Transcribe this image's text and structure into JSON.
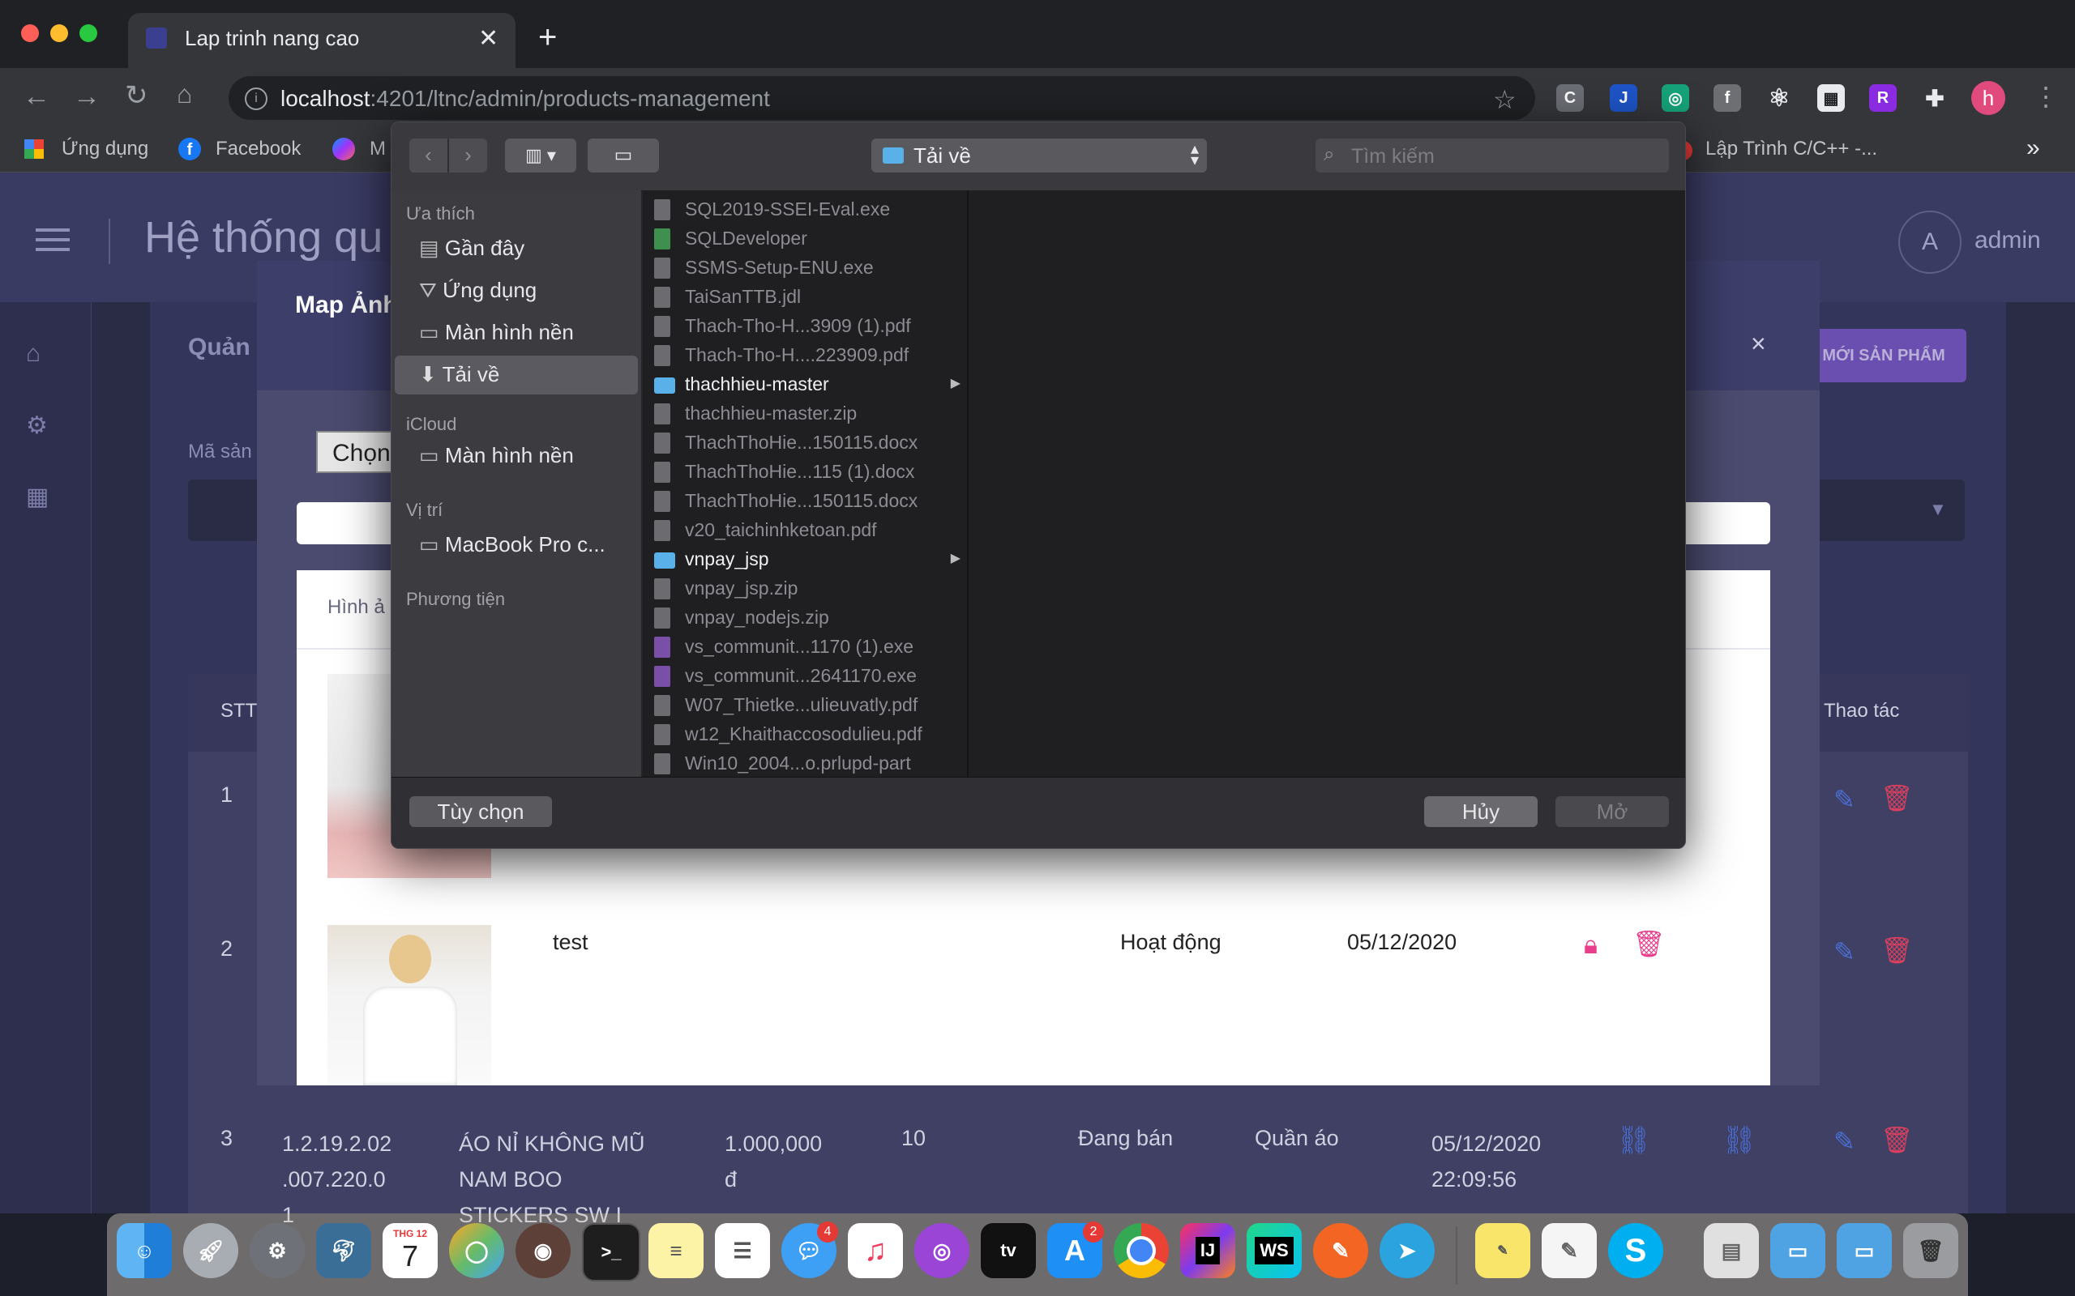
{
  "browser": {
    "tab_title": "Lap trinh nang cao",
    "url_host": "localhost",
    "url_path": ":4201/ltnc/admin/products-management",
    "profile_initial": "h",
    "bookmarks": [
      "Ứng dụng",
      "Facebook",
      "M",
      "Lập Trình C/C++ -..."
    ],
    "more_bookmarks": "»"
  },
  "app": {
    "title": "Hệ thống qu",
    "avatar_initial": "A",
    "user": "admin",
    "section": "Quản l",
    "filter_label": "Mã sản",
    "add_button": "M MỚI SẢN PHẨM",
    "columns": {
      "stt": "STT",
      "actions": "Thao tác"
    },
    "rows": [
      {
        "stt": "1"
      },
      {
        "stt": "2"
      },
      {
        "stt": "3",
        "code": [
          "1.2.19.2.02",
          ".007.220.0",
          "1"
        ],
        "name": [
          "ÁO NỈ KHÔNG MŨ",
          "NAM BOO",
          "STICKERS SW I"
        ],
        "price": [
          "1.000,000",
          "đ"
        ],
        "qty": "10",
        "status": "Đang bán",
        "category": "Quần áo",
        "date": [
          "05/12/2020",
          "22:09:56"
        ]
      }
    ]
  },
  "modal": {
    "title": "Map Ảnh",
    "close": "×",
    "choose_button": "Chọn",
    "col_image": "Hình ả",
    "row": {
      "name": "test",
      "status": "Hoạt động",
      "date": "05/12/2020"
    }
  },
  "dialog": {
    "location": "Tải về",
    "search_placeholder": "Tìm kiếm",
    "sidebar": {
      "favorites_header": "Ưa thích",
      "favorites": [
        "Gần đây",
        "Ứng dụng",
        "Màn hình nền",
        "Tải về"
      ],
      "icloud_header": "iCloud",
      "icloud": [
        "Màn hình nền"
      ],
      "locations_header": "Vị trí",
      "locations": [
        "MacBook Pro c..."
      ],
      "media_header": "Phương tiện"
    },
    "files": [
      "SQL2019-SSEI-Eval.exe",
      "SQLDeveloper",
      "SSMS-Setup-ENU.exe",
      "TaiSanTTB.jdl",
      "Thach-Tho-H...3909 (1).pdf",
      "Thach-Tho-H....223909.pdf",
      "thachhieu-master",
      "thachhieu-master.zip",
      "ThachThoHie...150115.docx",
      "ThachThoHie...115 (1).docx",
      "ThachThoHie...150115.docx",
      "v20_taichinhketoan.pdf",
      "vnpay_jsp",
      "vnpay_jsp.zip",
      "vnpay_nodejs.zip",
      "vs_communit...1170 (1).exe",
      "vs_communit...2641170.exe",
      "W07_Thietke...ulieuvatly.pdf",
      "w12_Khaithaccosodulieu.pdf",
      "Win10_2004...o.prlupd-part"
    ],
    "options_button": "Tùy chọn",
    "cancel_button": "Hủy",
    "open_button": "Mở"
  },
  "dock": {
    "calendar_month": "THG 12",
    "calendar_day": "7",
    "mail_badge": "4",
    "appstore_badge": "2"
  }
}
